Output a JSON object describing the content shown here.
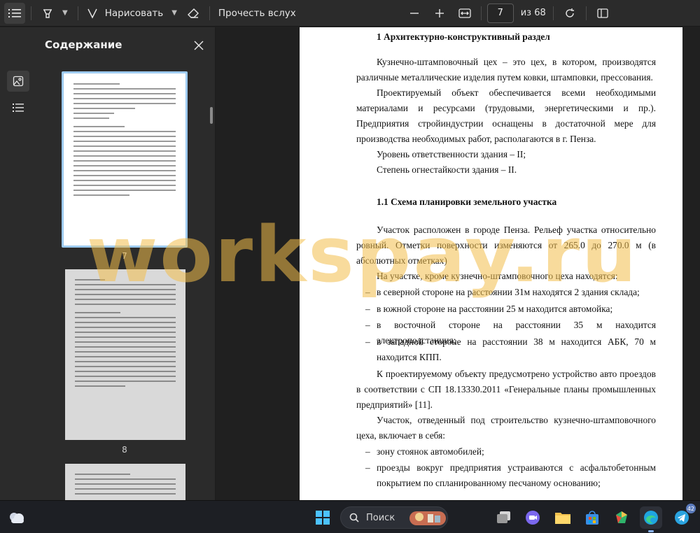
{
  "toolbar": {
    "draw_label": "Нарисовать",
    "read_aloud_label": "Прочесть вслух",
    "current_page": "7",
    "page_count_label": "из 68"
  },
  "sidebar": {
    "title": "Содержание",
    "thumbnails": [
      {
        "label": "7",
        "selected": true
      },
      {
        "label": "8",
        "selected": false
      }
    ]
  },
  "document": {
    "heading1": "1 Архитектурно-конструктивный раздел",
    "para1": "Кузнечно-штамповочный цех – это цех, в котором, производятся различные металлические изделия путем ковки, штамповки, прессования.",
    "para2": "Проектируемый объект обеспечивается всеми необходимыми материалами и ресурсами (трудовыми, энергетическими и пр.). Предприятия стройиндустрии оснащены в достаточной мере для производства необходимых работ, располагаются в г. Пенза.",
    "line_responsibility": "Уровень ответственности здания – II;",
    "line_fire": "Степень огнестайкости здания – II.",
    "heading2": "1.1 Схема планировки земельного участка",
    "para3": "Участок расположен в городе Пенза. Рельеф участка относительно ровный. Отметки поверхности изменяются от 265.0 до 270.0 м (в абсолютных отметках)",
    "para4": "На участке, кроме кузнечно-штамповочного цеха находятся:",
    "list1": [
      "в северной стороне на расстоянии 31м находятся 2 здания склада;",
      "в южной стороне на расстоянии 25 м находится автомойка;",
      "в восточной стороне на расстоянии 35 м находится электроподстанция;",
      "в западной стороне на расстоянии 38 м находится АБК, 70 м находится КПП."
    ],
    "para5": "К проектируемому объекту предусмотрено устройство авто проездов в соответствии с СП 18.13330.2011 «Генеральные планы промышленных предприятий» [11].",
    "para6": "Участок, отведенный под строительство кузнечно-штамповочного цеха, включает в себя:",
    "list2": [
      "зону стоянок автомобилей;",
      "проезды вокруг предприятия устраиваются с асфальтобетонным покрытием по спланированному песчаному основанию;"
    ],
    "dash": "–"
  },
  "watermark": "workspay.ru",
  "taskbar": {
    "search_label": "Поиск",
    "telegram_badge": "42"
  },
  "colors": {
    "accent": "#9ecbf0",
    "watermark": "#f2be4a",
    "toolbar_bg": "#2b2b2b",
    "canvas_bg": "#202020"
  }
}
